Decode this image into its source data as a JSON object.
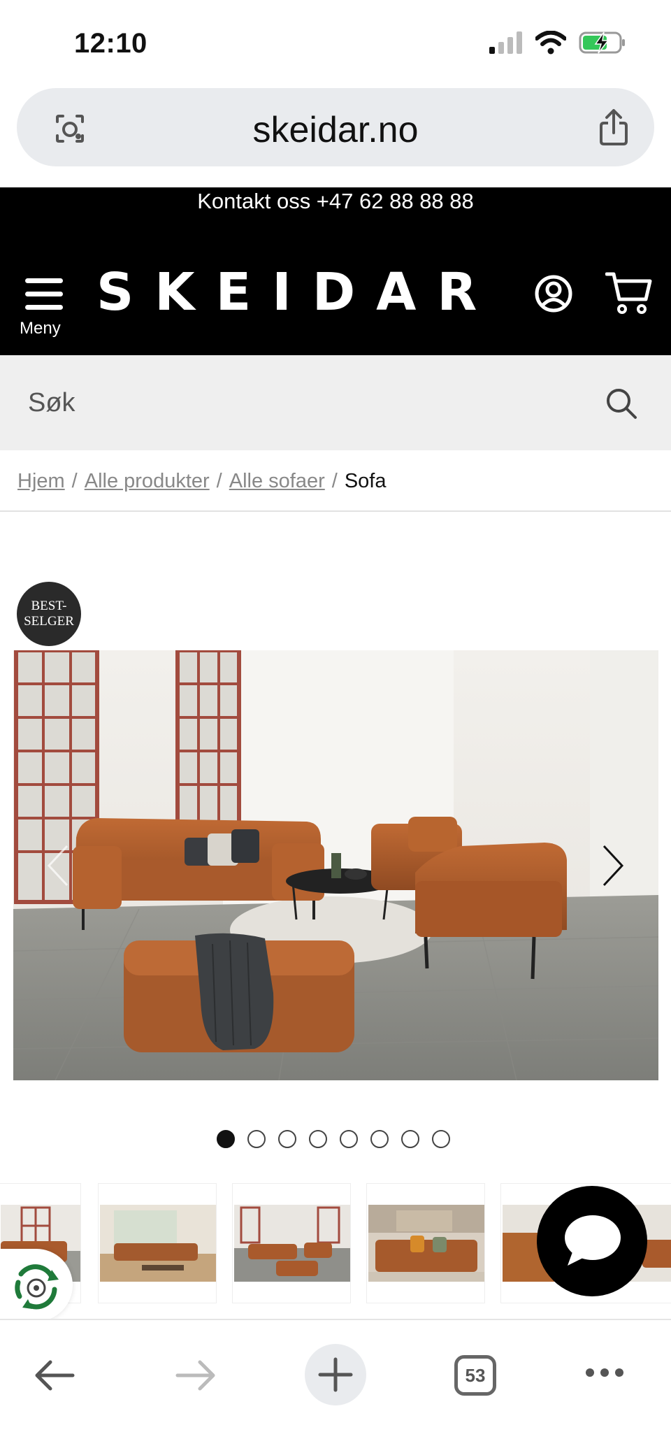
{
  "status": {
    "time": "12:10"
  },
  "browser": {
    "url": "skeidar.no",
    "tab_count": "53"
  },
  "header": {
    "contact": "Kontakt oss +47 62 88 88 88",
    "menu_label": "Meny",
    "logo": "SKEIDAR"
  },
  "search": {
    "placeholder": "Søk"
  },
  "breadcrumb": {
    "items": [
      "Hjem",
      "Alle produkter",
      "Alle sofaer"
    ],
    "separator": "/",
    "current": "Sofa"
  },
  "product": {
    "badge_line1": "BEST-",
    "badge_line2": "SELGER",
    "gallery_count": 8,
    "gallery_active": 1
  },
  "colors": {
    "header_bg": "#000000",
    "search_bg": "#efefef",
    "leather": "#a8582a"
  },
  "icons": [
    "camera-lens-icon",
    "share-icon",
    "menu-icon",
    "account-icon",
    "cart-icon",
    "search-icon",
    "chevron-left-icon",
    "chevron-right-icon",
    "chat-icon",
    "eco-icon",
    "back-arrow-icon",
    "forward-arrow-icon",
    "plus-icon",
    "more-icon"
  ]
}
